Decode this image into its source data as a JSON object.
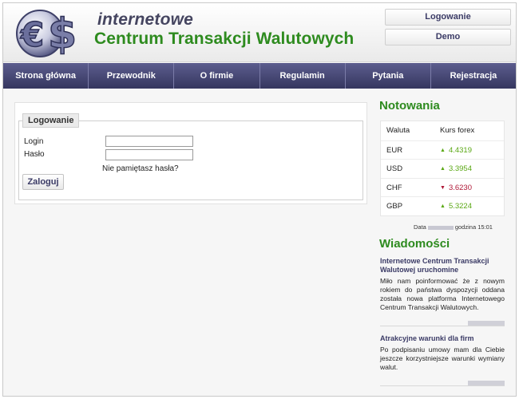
{
  "header": {
    "brand_top": "internetowe",
    "brand_main": "Centrum Transakcji Walutowych",
    "login_button": "Logowanie",
    "demo_button": "Demo"
  },
  "nav": {
    "items": [
      "Strona główna",
      "Przewodnik",
      "O firmie",
      "Regulamin",
      "Pytania",
      "Rejestracja"
    ]
  },
  "login": {
    "legend": "Logowanie",
    "login_label": "Login",
    "password_label": "Hasło",
    "login_value": "",
    "password_value": "",
    "forgot": "Nie pamiętasz hasła?",
    "submit": "Zaloguj"
  },
  "rates": {
    "title": "Notowania",
    "col_currency": "Waluta",
    "col_rate": "Kurs forex",
    "rows": [
      {
        "currency": "EUR",
        "rate": "4.4319",
        "trend": "up",
        "arrow": "▲"
      },
      {
        "currency": "USD",
        "rate": "3.3954",
        "trend": "up",
        "arrow": "▲"
      },
      {
        "currency": "CHF",
        "rate": "3.6230",
        "trend": "down",
        "arrow": "▼"
      },
      {
        "currency": "GBP",
        "rate": "5.3224",
        "trend": "up",
        "arrow": "▲"
      }
    ],
    "date_label": "Data",
    "time_label": "godzina 15:01"
  },
  "news": {
    "title": "Wiadomości",
    "items": [
      {
        "title": "Internetowe Centrum Transakcji Walutowej uruchomine",
        "body": "Miło nam poinformować że z nowym rokiem do państwa dyspozycji oddana została nowa platforma Internetowego Centrum Transakcji Walutowych."
      },
      {
        "title": "Atrakcyjne warunki dla firm",
        "body": "Po podpisaniu umowy mam dla Ciebie jeszcze korzystniejsze warunki wymiany walut."
      }
    ]
  },
  "colors": {
    "brand_green": "#2e8b1f",
    "nav_bg": "#35365f",
    "link_blue": "#3b3b66",
    "up": "#5aa814",
    "down": "#b01837"
  }
}
